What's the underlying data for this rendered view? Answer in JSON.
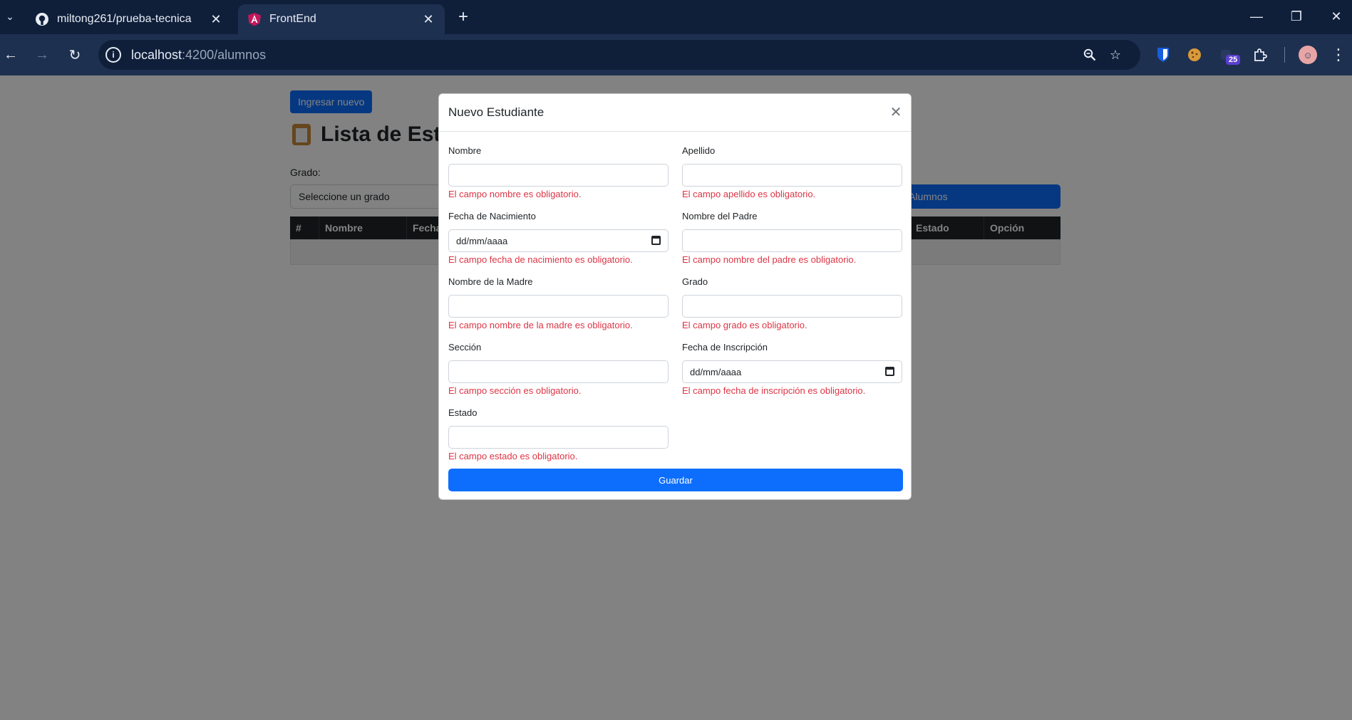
{
  "browser": {
    "tabs": [
      {
        "title": "miltong261/prueba-tecnica",
        "favicon": "github-icon",
        "active": false
      },
      {
        "title": "FrontEnd",
        "favicon": "angular-icon",
        "active": true
      }
    ],
    "url_host": "localhost",
    "url_path": ":4200/alumnos",
    "extension_badge": "25"
  },
  "page": {
    "new_button": "Ingresar nuevo",
    "title": "Lista de Estudiantes",
    "grado_label": "Grado:",
    "grado_select": "Seleccione un grado",
    "search_button": "Buscar Alumnos",
    "table_headers": [
      "#",
      "Nombre",
      "Fecha",
      "",
      "",
      "",
      "",
      "",
      "Estado",
      "Opción"
    ]
  },
  "modal": {
    "title": "Nuevo Estudiante",
    "submit": "Guardar",
    "fields": [
      {
        "label": "Nombre",
        "value": "",
        "error": "El campo nombre es obligatorio."
      },
      {
        "label": "Apellido",
        "value": "",
        "error": "El campo apellido es obligatorio."
      },
      {
        "label": "Fecha de Nacimiento",
        "value": "dd/mm/aaaa",
        "error": "El campo fecha de nacimiento es obligatorio."
      },
      {
        "label": "Nombre del Padre",
        "value": "",
        "error": "El campo nombre del padre es obligatorio."
      },
      {
        "label": "Nombre de la Madre",
        "value": "",
        "error": "El campo nombre de la madre es obligatorio."
      },
      {
        "label": "Grado",
        "value": "",
        "error": "El campo grado es obligatorio."
      },
      {
        "label": "Sección",
        "value": "",
        "error": "El campo sección es obligatorio."
      },
      {
        "label": "Fecha de Inscripción",
        "value": "dd/mm/aaaa",
        "error": "El campo fecha de inscripción es obligatorio."
      },
      {
        "label": "Estado",
        "value": "",
        "error": "El campo estado es obligatorio."
      }
    ]
  },
  "colors": {
    "primary": "#0d6efd",
    "danger": "#dc3545",
    "chrome_dark": "#0f1f3a",
    "chrome_toolbar": "#1e3050"
  }
}
